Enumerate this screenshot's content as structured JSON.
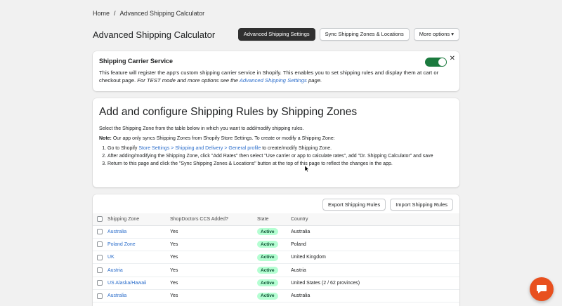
{
  "breadcrumb": {
    "home": "Home",
    "separator": "/",
    "current": "Advanced Shipping Calculator"
  },
  "page": {
    "title": "Advanced Shipping Calculator"
  },
  "header_buttons": {
    "settings": "Advanced Shipping Settings",
    "sync": "Sync Shipping Zones & Locations",
    "more": "More options ▾"
  },
  "carrier": {
    "title": "Shipping Carrier Service",
    "text_main": "This feature will register the app's custom shipping carrier service in Shopify. This enables you to set shipping rules and display them at cart or checkout page. ",
    "text_em": "For TEST mode and more options see the ",
    "link": "Advanced Shipping Settings",
    "text_end": " page.",
    "close": "✕",
    "toggle_on": true
  },
  "rules": {
    "heading": "Add and configure Shipping Rules by Shipping Zones",
    "intro": "Select the Shipping Zone from the table below in which you want to add/modify shipping rules.",
    "note_label": "Note:",
    "note_text": " Our app only syncs Shipping Zones from Shopify Store Settings. To create or modify a Shipping Zone:",
    "steps": {
      "s1_pre": "Go to Shopify ",
      "s1_link": "Store Settings > Shipping and Delivery > General profile",
      "s1_post": " to create/modify Shipping Zone.",
      "s2": "After adding/modifying the Shipping Zone, click \"Add Rates\" then select \"Use carrier or app to calculate rates\", add \"Dr. Shipping Calculator\" and save",
      "s3": "Return to this page and click the \"Sync Shipping Zones & Locations\" button at the top of this page to reflect the changes in the app."
    }
  },
  "table": {
    "export_btn": "Export Shipping Rules",
    "import_btn": "Import Shipping Rules",
    "headers": {
      "zone": "Shipping Zone",
      "ccs": "ShopDoctors CCS Added?",
      "state": "State",
      "country": "Country"
    },
    "rows": [
      {
        "zone": "Australia",
        "ccs": "Yes",
        "state": "Active",
        "country": "Australia"
      },
      {
        "zone": "Poland Zone",
        "ccs": "Yes",
        "state": "Active",
        "country": "Poland"
      },
      {
        "zone": "UK",
        "ccs": "Yes",
        "state": "Active",
        "country": "United Kingdom"
      },
      {
        "zone": "Austria",
        "ccs": "Yes",
        "state": "Active",
        "country": "Austria"
      },
      {
        "zone": "US Alaska/Hawaii",
        "ccs": "Yes",
        "state": "Active",
        "country": "United States (2 / 62 provinces)"
      },
      {
        "zone": "Australia",
        "ccs": "Yes",
        "state": "Active",
        "country": "Australia"
      }
    ]
  },
  "colors": {
    "accent": "#2c6ecb",
    "toggle": "#1b7a3e",
    "badge_bg": "#b4fed2",
    "chat": "#e8501f"
  }
}
